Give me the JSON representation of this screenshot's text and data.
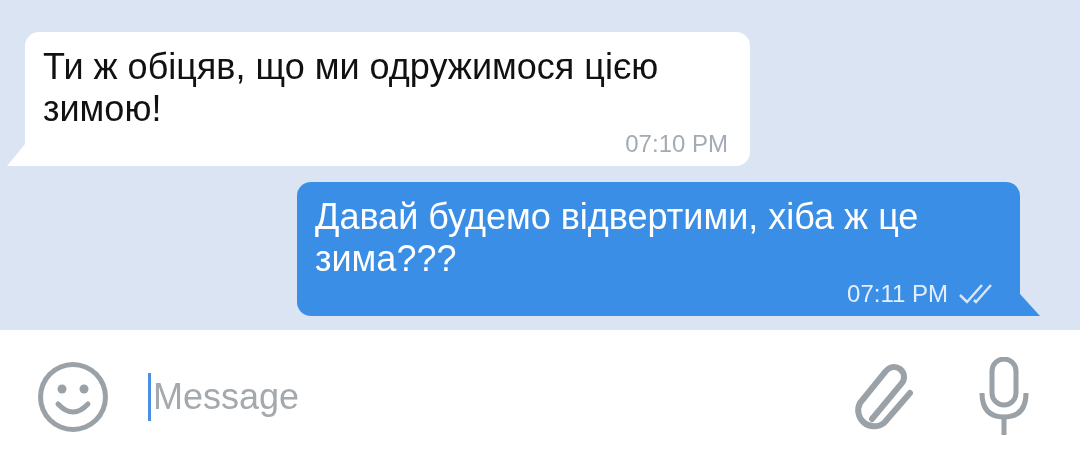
{
  "messages": [
    {
      "kind": "incoming",
      "text": "Ти ж обіцяв, що ми одружимося цією зимою!",
      "time": "07:10 PM"
    },
    {
      "kind": "outgoing",
      "text": "Давай будемо відвертими, хіба ж це зима???",
      "time": "07:11 PM",
      "read": true
    }
  ],
  "composer": {
    "placeholder": "Message",
    "focused": true
  }
}
